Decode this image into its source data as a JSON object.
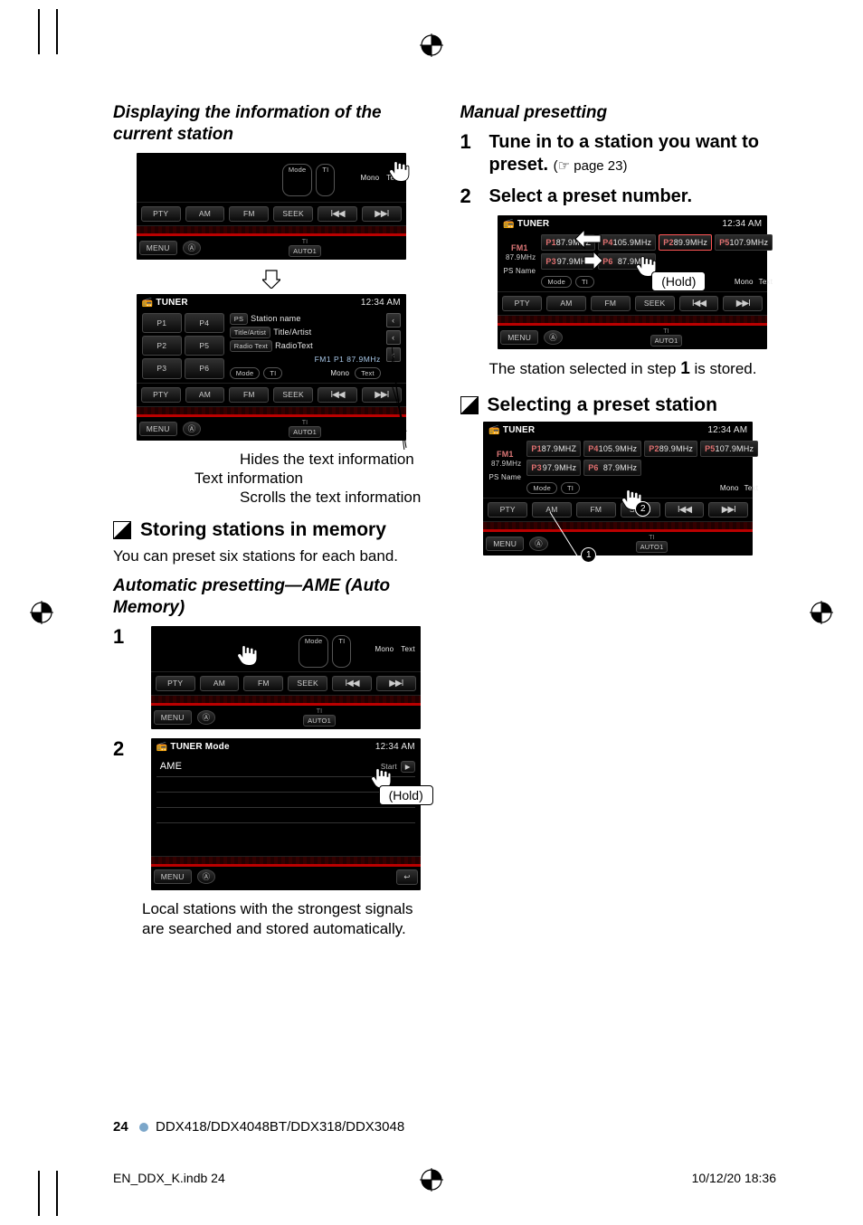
{
  "left": {
    "h3_display": "Displaying the information of the current station",
    "screen1": {
      "mode_items": [
        "Mode",
        "TI",
        "Mono",
        "Text"
      ],
      "row": [
        "PTY",
        "AM",
        "FM",
        "SEEK",
        "I◀◀",
        "▶▶I"
      ],
      "bottom": [
        "MENU",
        "Ⓐ",
        "TI",
        "AUTO1"
      ]
    },
    "screen2": {
      "title": "TUNER",
      "clock": "12:34 AM",
      "left_presets": [
        "P1",
        "P4",
        "P2",
        "P5",
        "P3",
        "P6"
      ],
      "ps_label": "PS",
      "station": "Station name",
      "ta_label": "Title/Artist",
      "ta_value": "Title/Artist",
      "rt_label": "Radio Text",
      "rt_value": "RadioText",
      "band_line": "FM1   P1          87.9MHz",
      "mode_items": [
        "Mode",
        "TI",
        "Mono",
        "Text"
      ],
      "row": [
        "PTY",
        "AM",
        "FM",
        "SEEK",
        "I◀◀",
        "▶▶I"
      ],
      "bottom": [
        "MENU",
        "Ⓐ",
        "TI",
        "AUTO1"
      ]
    },
    "annot_hide": "Hides the text information",
    "annot_text": "Text information",
    "annot_scroll": "Scrolls the text information",
    "h2_store": "Storing stations in memory",
    "store_body": "You can preset six stations for each band.",
    "h3_ame": "Automatic presetting—AME (Auto Memory)",
    "step1_num": "1",
    "step1_screen": {
      "mode_items": [
        "Mode",
        "TI",
        "Mono",
        "Text"
      ],
      "row": [
        "PTY",
        "AM",
        "FM",
        "SEEK",
        "I◀◀",
        "▶▶I"
      ],
      "bottom": [
        "MENU",
        "Ⓐ",
        "TI",
        "AUTO1"
      ]
    },
    "step2_num": "2",
    "step2_screen": {
      "title": "TUNER Mode",
      "clock": "12:34 AM",
      "item": "AME",
      "start": "Start",
      "menu": "MENU",
      "back": "↩"
    },
    "hold_label": "(Hold)",
    "step2_body": "Local stations with the strongest signals are searched and stored automatically."
  },
  "right": {
    "h3_manual": "Manual presetting",
    "step1_num": "1",
    "step1_text": "Tune in to a station you want to preset.",
    "step1_ref": "(☞ page 23)",
    "step2_num": "2",
    "step2_text": "Select a preset number.",
    "screen_manual": {
      "title": "TUNER",
      "clock": "12:34 AM",
      "left_band": "FM1",
      "left_freq": "87.9MHz",
      "ps": "PS Name",
      "p1": "P1",
      "p1v": "87.9MHZ",
      "p2": "P2",
      "p2v": "89.9MHz",
      "p3": "P3",
      "p3v": "97.9MHz",
      "p4": "P4",
      "p4v": "105.9MHz",
      "p5": "P5",
      "p5v": "107.9MHz",
      "p6": "P6",
      "p6v": "87.9MHz",
      "mode_items": [
        "Mode",
        "TI",
        "Mono",
        "Text"
      ],
      "row": [
        "PTY",
        "AM",
        "FM",
        "SEEK",
        "I◀◀",
        "▶▶I"
      ],
      "bottom": [
        "MENU",
        "Ⓐ",
        "TI",
        "AUTO1"
      ]
    },
    "hold_label": "(Hold)",
    "stored_text_a": "The station selected in step ",
    "stored_text_num": "1",
    "stored_text_b": " is stored.",
    "h2_select": "Selecting a preset station",
    "screen_select": {
      "title": "TUNER",
      "clock": "12:34 AM",
      "left_band": "FM1",
      "left_freq": "87.9MHz",
      "ps": "PS Name",
      "p1": "P1",
      "p1v": "87.9MHZ",
      "p2": "P2",
      "p2v": "89.9MHz",
      "p3": "P3",
      "p3v": "97.9MHz",
      "p4": "P4",
      "p4v": "105.9MHz",
      "p5": "P5",
      "p5v": "107.9MHz",
      "p6": "P6",
      "p6v": "87.9MHz",
      "mode_items": [
        "Mode",
        "TI",
        "Mono",
        "Text"
      ],
      "row": [
        "PTY",
        "AM",
        "FM",
        "SEEK",
        "I◀◀",
        "▶▶I"
      ],
      "bottom": [
        "MENU",
        "Ⓐ",
        "TI",
        "AUTO1"
      ]
    },
    "circ1": "1",
    "circ2": "2"
  },
  "footer": {
    "page": "24",
    "models": "DDX418/DDX4048BT/DDX318/DDX3048"
  },
  "print": {
    "file": "EN_DDX_K.indb   24",
    "date": "10/12/20   18:36"
  }
}
